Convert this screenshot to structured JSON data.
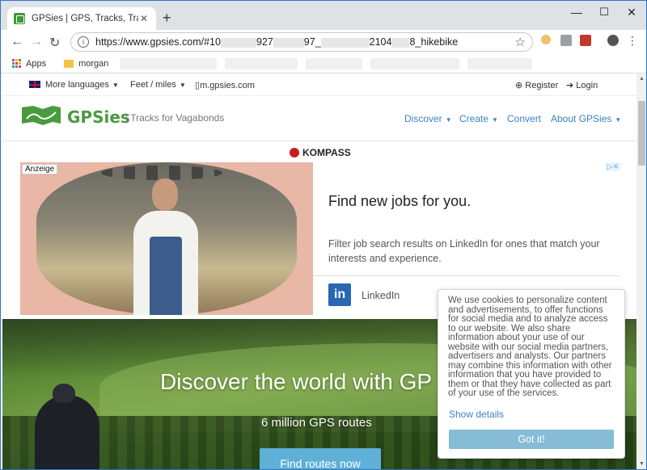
{
  "browser": {
    "tab_title": "GPSies | GPS, Tracks, Trails, Tours",
    "url_start": "https://www.gpsies.com/#10",
    "url_part2": "927",
    "url_part3": "97_",
    "url_part4": "2104",
    "url_end": "8_hikebike",
    "bookmarks": {
      "apps_label": "Apps",
      "folder_label": "morgan"
    }
  },
  "site": {
    "topbar": {
      "languages": "More languages",
      "units": "Feet / miles",
      "mobile": "m.gpsies.com",
      "register": "Register",
      "login": "Login"
    },
    "logo_text": "GPSies",
    "tagline": "| Tracks for Vagabonds",
    "nav": {
      "discover": "Discover",
      "create": "Create",
      "convert": "Convert",
      "about": "About GPSies"
    },
    "sponsor": "KOMPASS"
  },
  "ad": {
    "label": "Anzeige",
    "headline": "Find new jobs for you.",
    "description": "Filter job search results on LinkedIn for ones that match your interests and experience.",
    "advertiser": "LinkedIn",
    "advertiser_logo": "in"
  },
  "hero": {
    "title": "Discover the world with GP",
    "subtitle": "6 million GPS routes",
    "cta": "Find routes now"
  },
  "cookie": {
    "text": "We use cookies to personalize content and advertisements, to offer functions for social media and to analyze access to our website. We also share information about your use of our website with our social media partners, advertisers and analysts. Our partners may combine this information with other information that you have provided to them or that they have collected as part of your use of the services.",
    "details_link": "Show details",
    "accept_button": "Got it!"
  },
  "colors": {
    "brand_green": "#4a9a3e",
    "link_blue": "#3a83c4",
    "cookie_button": "#86bcd6",
    "hero_button": "#5fb0d6"
  }
}
